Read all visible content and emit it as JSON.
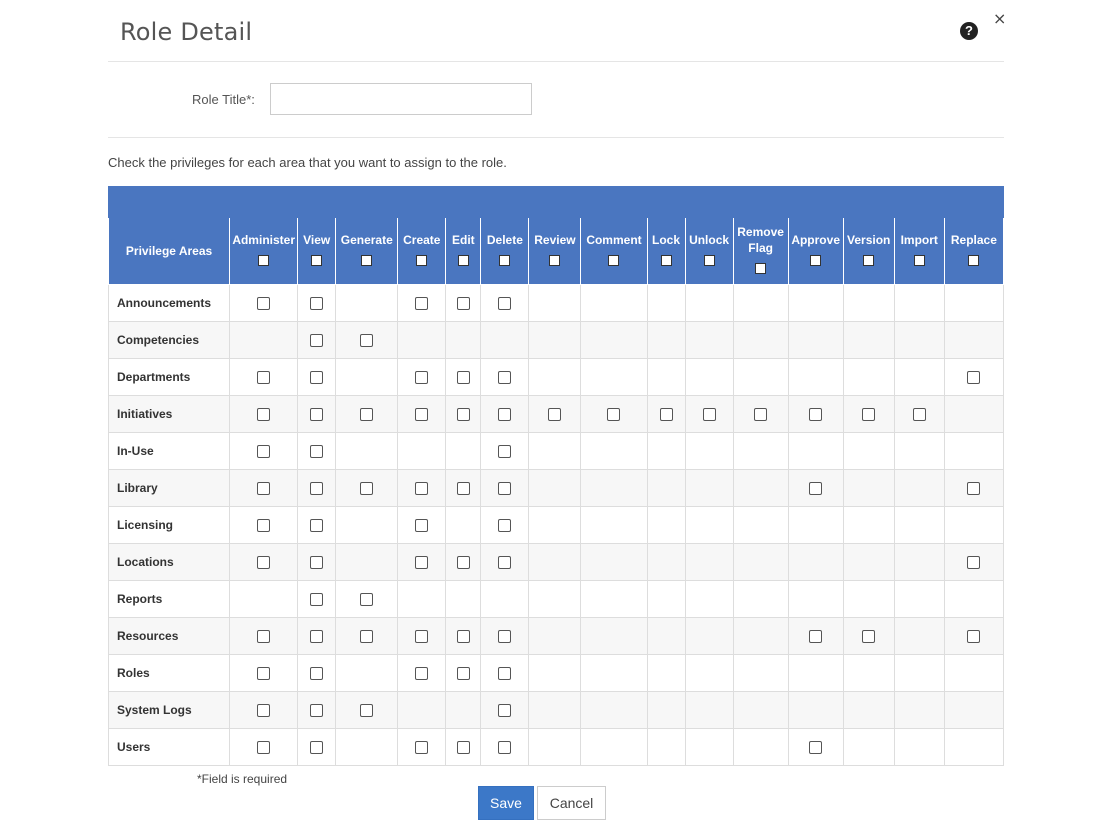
{
  "dialog": {
    "title": "Role Detail",
    "help_icon": "question-circle-icon",
    "help_glyph": "?",
    "close_icon": "close-icon",
    "close_glyph": "×"
  },
  "form": {
    "role_title_label": "Role Title*:",
    "role_title_value": "",
    "instructions": "Check the privileges for each area that you want to assign to the role.",
    "required_note": "*Field is required"
  },
  "table": {
    "area_header": "Privilege Areas",
    "columns": [
      "Administer",
      "View",
      "Generate",
      "Create",
      "Edit",
      "Delete",
      "Review",
      "Comment",
      "Lock",
      "Unlock",
      "Remove Flag",
      "Approve",
      "Version",
      "Import",
      "Replace"
    ],
    "rows": [
      {
        "area": "Announcements",
        "cells": [
          1,
          1,
          0,
          1,
          1,
          1,
          0,
          0,
          0,
          0,
          0,
          0,
          0,
          0,
          0
        ]
      },
      {
        "area": "Competencies",
        "cells": [
          0,
          1,
          1,
          0,
          0,
          0,
          0,
          0,
          0,
          0,
          0,
          0,
          0,
          0,
          0
        ]
      },
      {
        "area": "Departments",
        "cells": [
          1,
          1,
          0,
          1,
          1,
          1,
          0,
          0,
          0,
          0,
          0,
          0,
          0,
          0,
          1
        ]
      },
      {
        "area": "Initiatives",
        "cells": [
          1,
          1,
          1,
          1,
          1,
          1,
          1,
          1,
          1,
          1,
          1,
          1,
          1,
          1,
          0
        ]
      },
      {
        "area": "In-Use",
        "cells": [
          1,
          1,
          0,
          0,
          0,
          1,
          0,
          0,
          0,
          0,
          0,
          0,
          0,
          0,
          0
        ]
      },
      {
        "area": "Library",
        "cells": [
          1,
          1,
          1,
          1,
          1,
          1,
          0,
          0,
          0,
          0,
          0,
          1,
          0,
          0,
          1
        ]
      },
      {
        "area": "Licensing",
        "cells": [
          1,
          1,
          0,
          1,
          0,
          1,
          0,
          0,
          0,
          0,
          0,
          0,
          0,
          0,
          0
        ]
      },
      {
        "area": "Locations",
        "cells": [
          1,
          1,
          0,
          1,
          1,
          1,
          0,
          0,
          0,
          0,
          0,
          0,
          0,
          0,
          1
        ]
      },
      {
        "area": "Reports",
        "cells": [
          0,
          1,
          1,
          0,
          0,
          0,
          0,
          0,
          0,
          0,
          0,
          0,
          0,
          0,
          0
        ]
      },
      {
        "area": "Resources",
        "cells": [
          1,
          1,
          1,
          1,
          1,
          1,
          0,
          0,
          0,
          0,
          0,
          1,
          1,
          0,
          1
        ]
      },
      {
        "area": "Roles",
        "cells": [
          1,
          1,
          0,
          1,
          1,
          1,
          0,
          0,
          0,
          0,
          0,
          0,
          0,
          0,
          0
        ]
      },
      {
        "area": "System Logs",
        "cells": [
          1,
          1,
          1,
          0,
          0,
          1,
          0,
          0,
          0,
          0,
          0,
          0,
          0,
          0,
          0
        ]
      },
      {
        "area": "Users",
        "cells": [
          1,
          1,
          0,
          1,
          1,
          1,
          0,
          0,
          0,
          0,
          0,
          1,
          0,
          0,
          0
        ]
      }
    ]
  },
  "buttons": {
    "save_label": "Save",
    "cancel_label": "Cancel"
  },
  "colors": {
    "header_bg": "#4a76c0",
    "save_bg": "#3c78c8"
  }
}
